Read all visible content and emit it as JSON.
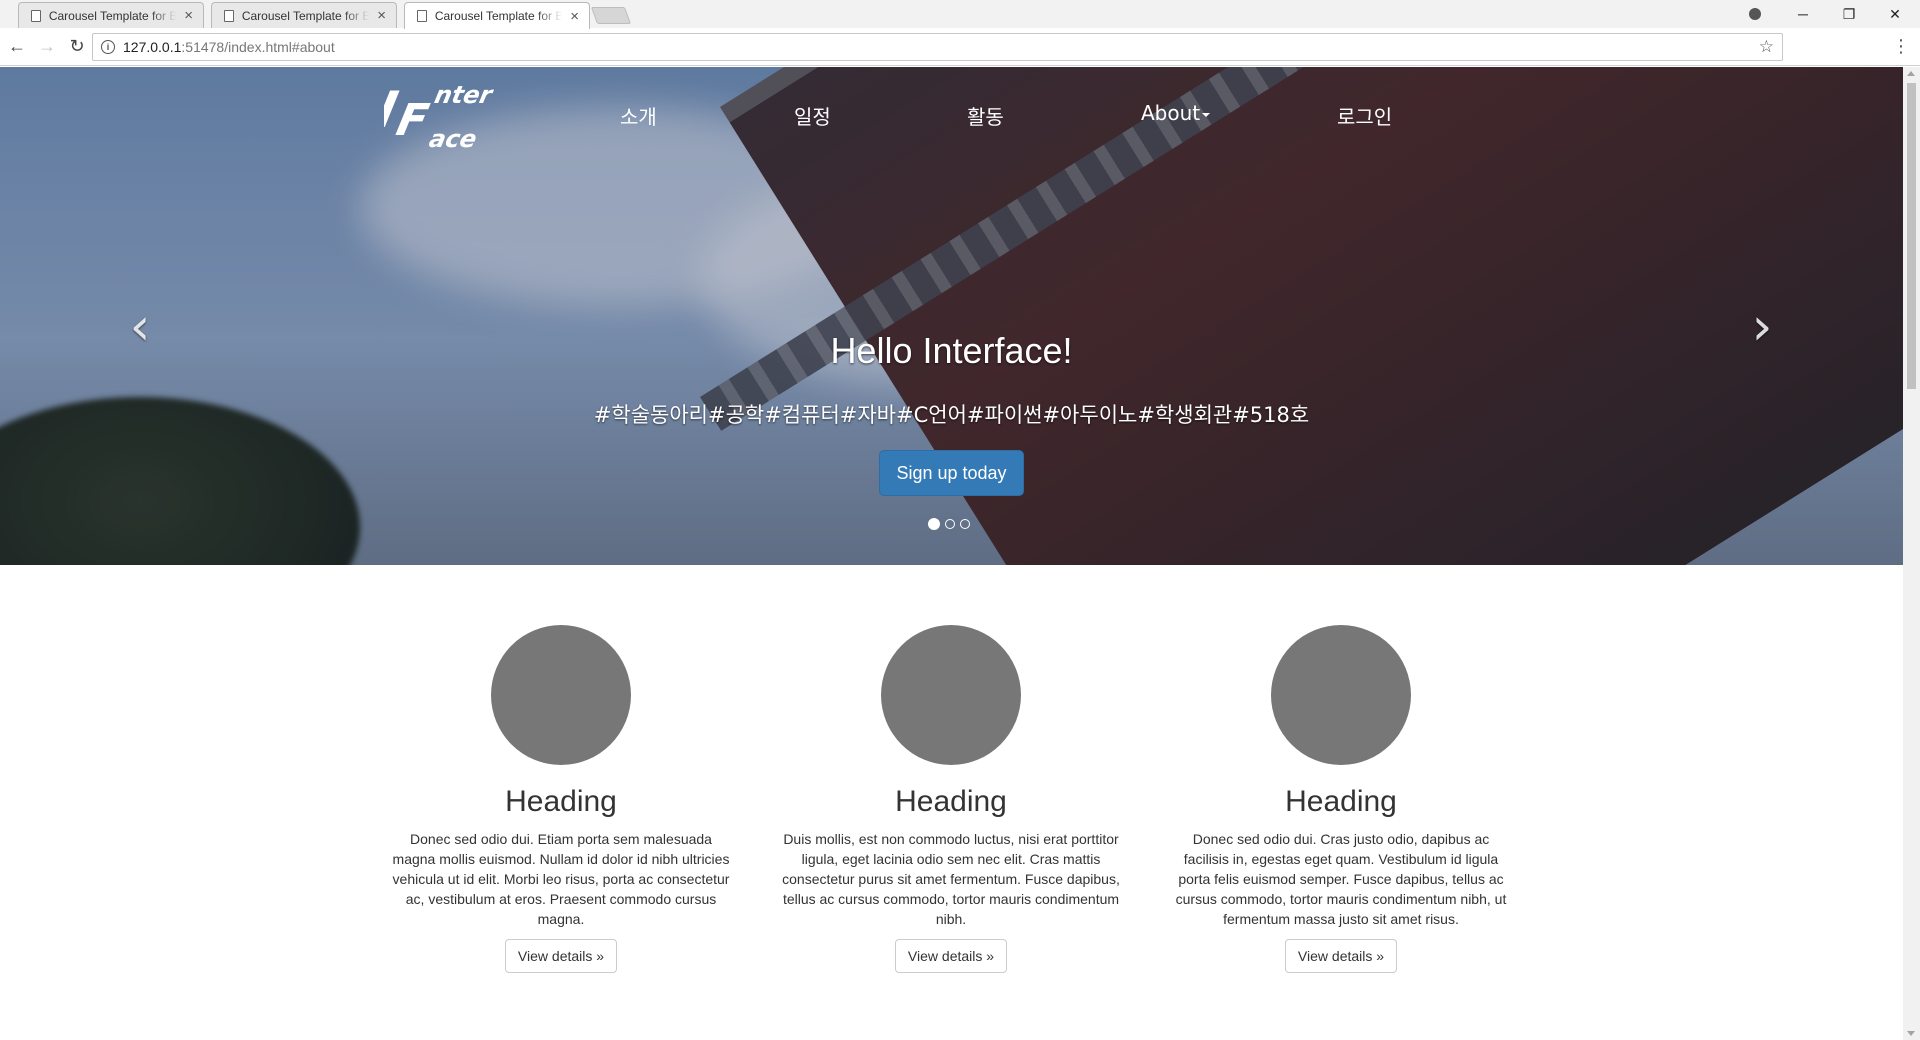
{
  "browser": {
    "tabs": [
      {
        "title": "Carousel Template for Bootstrap",
        "active": false
      },
      {
        "title": "Carousel Template for Bootstrap",
        "active": false
      },
      {
        "title": "Carousel Template for Bootstrap",
        "active": true
      }
    ],
    "url_host": "127.0.0.1",
    "url_rest": ":51478/index.html#about"
  },
  "nav": {
    "logo_text": "InterFace",
    "items": [
      "소개",
      "일정",
      "활동",
      "About",
      "로그인"
    ]
  },
  "carousel": {
    "title": "Hello Interface!",
    "tags": "#학술동아리#공학#컴퓨터#자바#C언어#파이썬#아두이노#학생회관#518호",
    "button": "Sign up today",
    "prev_glyph": "‹",
    "next_glyph": "›",
    "indicator_count": 3,
    "active_indicator": 1
  },
  "columns": [
    {
      "heading": "Heading",
      "text": "Donec sed odio dui. Etiam porta sem malesuada magna mollis euismod. Nullam id dolor id nibh ultricies vehicula ut id elit. Morbi leo risus, porta ac consectetur ac, vestibulum at eros. Praesent commodo cursus magna.",
      "button": "View details »"
    },
    {
      "heading": "Heading",
      "text": "Duis mollis, est non commodo luctus, nisi erat porttitor ligula, eget lacinia odio sem nec elit. Cras mattis consectetur purus sit amet fermentum. Fusce dapibus, tellus ac cursus commodo, tortor mauris condimentum nibh.",
      "button": "View details »"
    },
    {
      "heading": "Heading",
      "text": "Donec sed odio dui. Cras justo odio, dapibus ac facilisis in, egestas eget quam. Vestibulum id ligula porta felis euismod semper. Fusce dapibus, tellus ac cursus commodo, tortor mauris condimentum nibh, ut fermentum massa justo sit amet risus.",
      "button": "View details »"
    }
  ],
  "colors": {
    "primary_button": "#337ab7",
    "placeholder_circle": "#777777"
  }
}
